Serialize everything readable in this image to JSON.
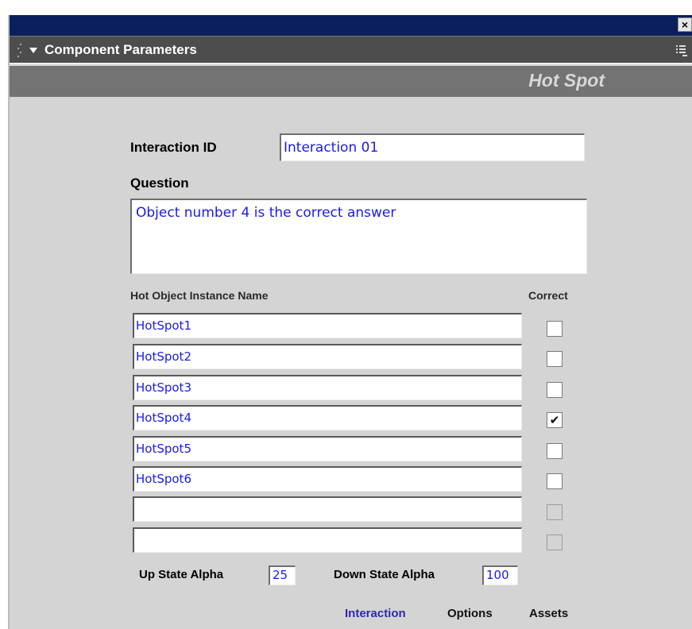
{
  "panel": {
    "title": "Component Parameters",
    "close_glyph": "×"
  },
  "banner": {
    "text": "Hot Spot"
  },
  "form": {
    "interaction_id_label": "Interaction ID",
    "interaction_id_value": "Interaction  01",
    "question_label": "Question",
    "question_value": "Object number 4 is the correct answer",
    "col_name_header": "Hot Object Instance Name",
    "col_correct_header": "Correct",
    "hotspots": [
      {
        "name": "HotSpot1",
        "correct": false,
        "enabled": true
      },
      {
        "name": "HotSpot2",
        "correct": false,
        "enabled": true
      },
      {
        "name": "HotSpot3",
        "correct": false,
        "enabled": true
      },
      {
        "name": "HotSpot4",
        "correct": true,
        "enabled": true
      },
      {
        "name": "HotSpot5",
        "correct": false,
        "enabled": true
      },
      {
        "name": "HotSpot6",
        "correct": false,
        "enabled": true
      },
      {
        "name": "",
        "correct": false,
        "enabled": false
      },
      {
        "name": "",
        "correct": false,
        "enabled": false
      }
    ],
    "up_state_alpha_label": "Up State Alpha",
    "up_state_alpha_value": "25",
    "down_state_alpha_label": "Down State Alpha",
    "down_state_alpha_value": "100"
  },
  "tabs": {
    "interaction": "Interaction",
    "options": "Options",
    "assets": "Assets"
  },
  "colors": {
    "title_bar": "#0b1e5e",
    "panel_bg": "#d4d4d4",
    "field_text": "#1a1aee",
    "active_tab": "#2b2bb0"
  }
}
